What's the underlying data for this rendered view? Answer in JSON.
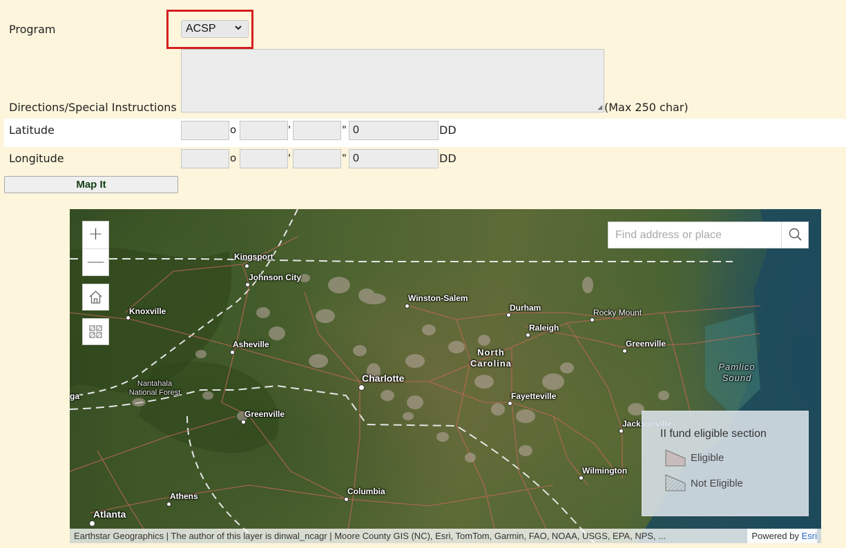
{
  "form": {
    "program": {
      "label": "Program",
      "selected": "ACSP"
    },
    "directions": {
      "label": "Directions/Special Instructions",
      "value": "",
      "note": "(Max 250 char)"
    },
    "latitude": {
      "label": "Latitude",
      "deg": "",
      "deg_sym": "o",
      "min": "",
      "min_sym": "'",
      "sec": "",
      "sec_sym": "\"",
      "dd": "0",
      "dd_unit": "DD"
    },
    "longitude": {
      "label": "Longitude",
      "deg": "",
      "deg_sym": "o",
      "min": "",
      "min_sym": "'",
      "sec": "",
      "sec_sym": "\"",
      "dd": "0",
      "dd_unit": "DD"
    },
    "map_button": "Map It"
  },
  "map": {
    "search_placeholder": "Find address or place",
    "zoom_in": "+",
    "zoom_out": "—",
    "legend": {
      "title": "II fund eligible section",
      "items": [
        "Eligible",
        "Not Eligible"
      ]
    },
    "labels": {
      "kingsport": "Kingsport",
      "johnson_city": "Johnson City",
      "knoxville": "Knoxville",
      "winston_salem": "Winston-Salem",
      "durham": "Durham",
      "rocky_mount": "Rocky Mount",
      "raleigh": "Raleigh",
      "asheville": "Asheville",
      "greenville_nc": "Greenville",
      "north": "North",
      "carolina": "Carolina",
      "pamlico": "Pamlico",
      "sound": "Sound",
      "charlotte": "Charlotte",
      "nantahala": "Nantahala",
      "national_forest": "National Forest",
      "ga": "ga",
      "fayetteville": "Fayetteville",
      "greenville_sc": "Greenville",
      "jacksonville": "Jacksonville",
      "wilmington": "Wilmington",
      "athens": "Athens",
      "columbia": "Columbia",
      "atlanta": "Atlanta"
    },
    "attribution": "Earthstar Geographics | The author of this layer is dinwal_ncagr | Moore County GIS (NC), Esri, TomTom, Garmin, FAO, NOAA, USGS, EPA, NPS, ...",
    "powered_by": "Powered by",
    "esri": "Esri"
  },
  "icons": {
    "select_chevron": "chevron-down-icon",
    "home": "home-icon",
    "basemap": "basemap-gallery-icon",
    "search": "search-icon"
  },
  "colors": {
    "page_bg": "#fdf5dc",
    "highlight": "#d42020",
    "link": "#2c6bc9"
  }
}
